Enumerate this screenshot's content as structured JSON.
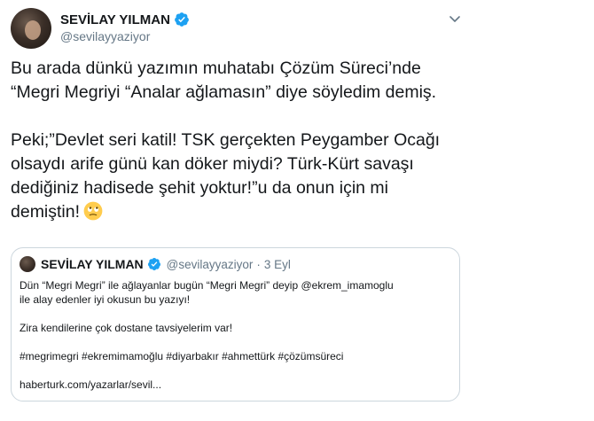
{
  "tweet": {
    "author": {
      "display_name": "SEVİLAY YILMAN",
      "handle": "@sevilayyaziyor",
      "verified": true
    },
    "text": {
      "paragraph1": "Bu arada dünkü yazımın muhatabı Çözüm Süreci’nde\n“Megri Megriyi “Analar ağlamasın” diye söyledim demiş.",
      "paragraph2": "Peki;”Devlet seri katil! TSK gerçekten Peygamber Ocağı\nolsaydı arife günü kan döker miydi? Türk-Kürt savaşı\ndediğiniz hadisede şehit yoktur!”u da onun için mi\ndemiştin!"
    },
    "emoji": "face-with-rolling-eyes-emoji",
    "menu_icon": "chevron-down-icon"
  },
  "quoted_tweet": {
    "author": {
      "display_name": "SEVİLAY YILMAN",
      "handle": "@sevilayyaziyor",
      "separator": "·",
      "date": "3 Eyl",
      "verified": true
    },
    "line1": "Dün “Megri Megri” ile ağlayanlar bugün “Megri Megri” deyip @ekrem_imamoglu",
    "line2": "ile alay edenler iyi okusun bu yazıyı!",
    "line3": "Zira kendilerine çok dostane tavsiyelerim var!",
    "hashtags": "#megrimegri #ekremimamoğlu #diyarbakır #ahmettürk #çözümsüreci",
    "link": "haberturk.com/yazarlar/sevil..."
  },
  "colors": {
    "verified_blue": "#1da1f2",
    "secondary_text": "#657786",
    "border": "#ccd6dd"
  }
}
